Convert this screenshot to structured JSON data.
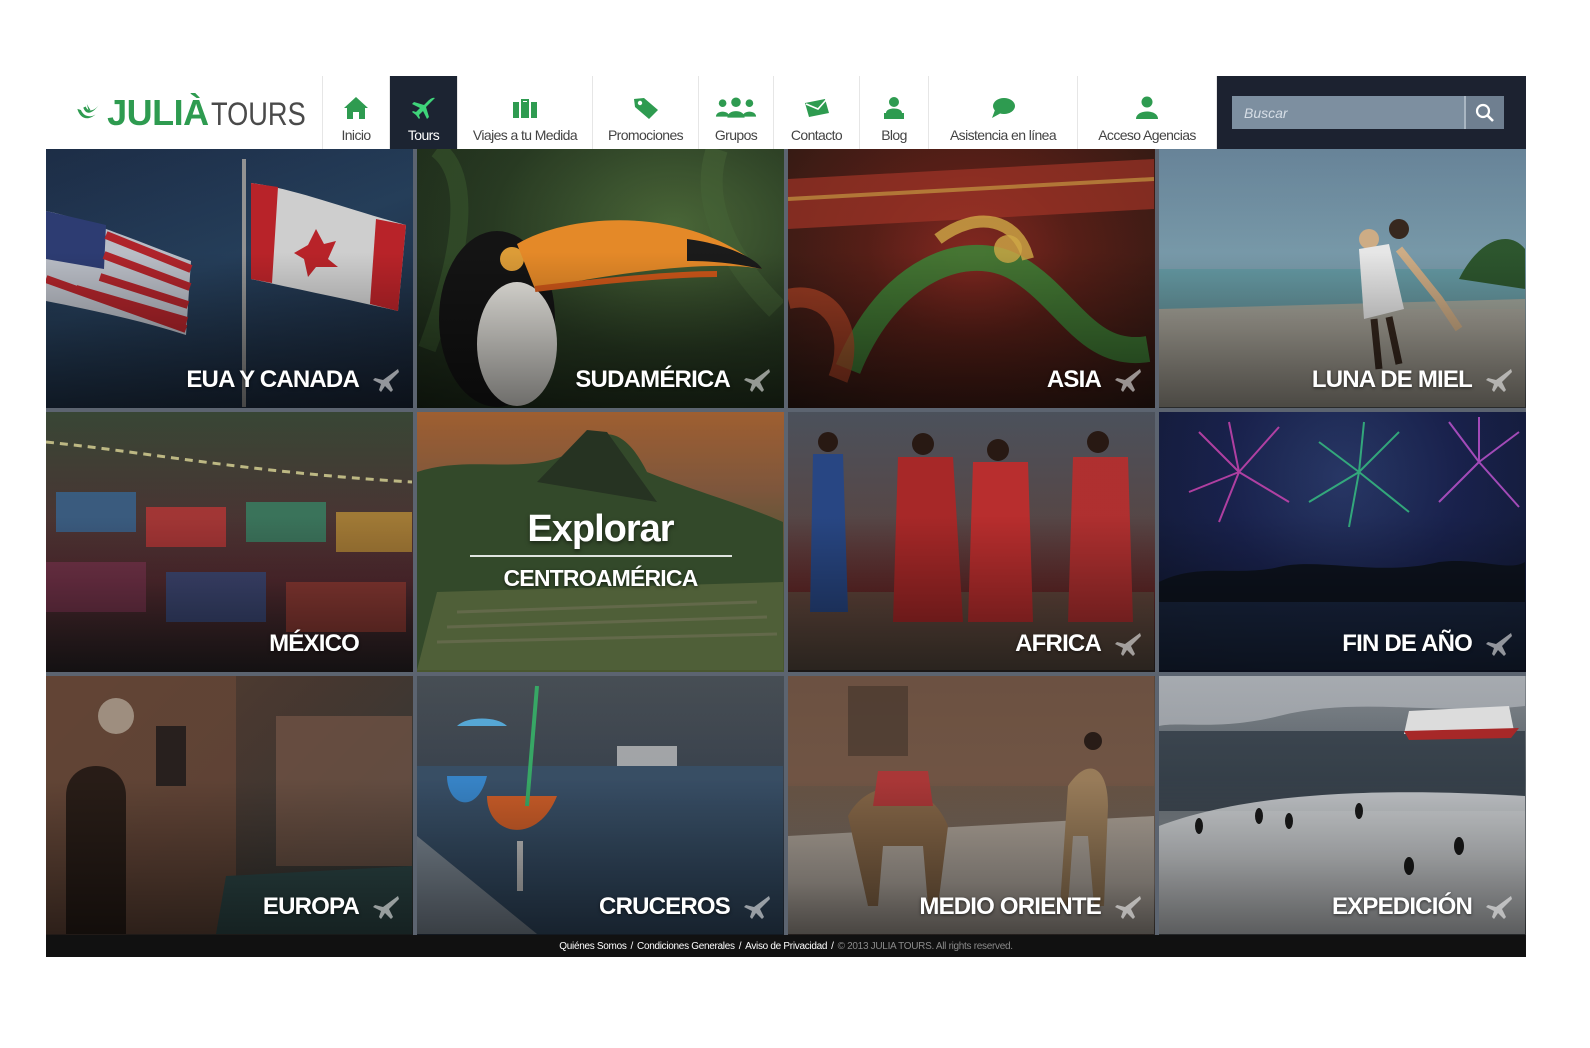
{
  "brand": {
    "name_bold": "JULIÀ",
    "name_light": "TOURS",
    "color_green": "#2e9b50"
  },
  "nav": [
    {
      "label": "Inicio",
      "icon": "home-icon",
      "active": false
    },
    {
      "label": "Tours",
      "icon": "plane-icon",
      "active": true
    },
    {
      "label": "Viajes a tu Medida",
      "icon": "suitcase-icon",
      "active": false
    },
    {
      "label": "Promociones",
      "icon": "tag-icon",
      "active": false
    },
    {
      "label": "Grupos",
      "icon": "group-icon",
      "active": false
    },
    {
      "label": "Contacto",
      "icon": "envelope-icon",
      "active": false
    },
    {
      "label": "Blog",
      "icon": "person-desk-icon",
      "active": false
    },
    {
      "label": "Asistencia en línea",
      "icon": "chat-icon",
      "active": false
    },
    {
      "label": "Acceso Agencias",
      "icon": "user-icon",
      "active": false
    }
  ],
  "search": {
    "placeholder": "Buscar"
  },
  "tiles": [
    {
      "label": "EUA Y CANADA"
    },
    {
      "label": "SUDAMÉRICA"
    },
    {
      "label": "ASIA"
    },
    {
      "label": "LUNA DE MIEL"
    },
    {
      "label": "MÉXICO"
    },
    {
      "label": "Explorar",
      "sublabel": "CENTROAMÉRICA"
    },
    {
      "label": "AFRICA"
    },
    {
      "label": "FIN DE AÑO"
    },
    {
      "label": "EUROPA"
    },
    {
      "label": "CRUCEROS"
    },
    {
      "label": "MEDIO ORIENTE"
    },
    {
      "label": "EXPEDICIÓN"
    }
  ],
  "footer": {
    "links": [
      "Quiénes Somos",
      "Condiciones Generales",
      "Aviso de Privacidad"
    ],
    "copyright": "© 2013 JULIA TOURS. All rights reserved."
  }
}
